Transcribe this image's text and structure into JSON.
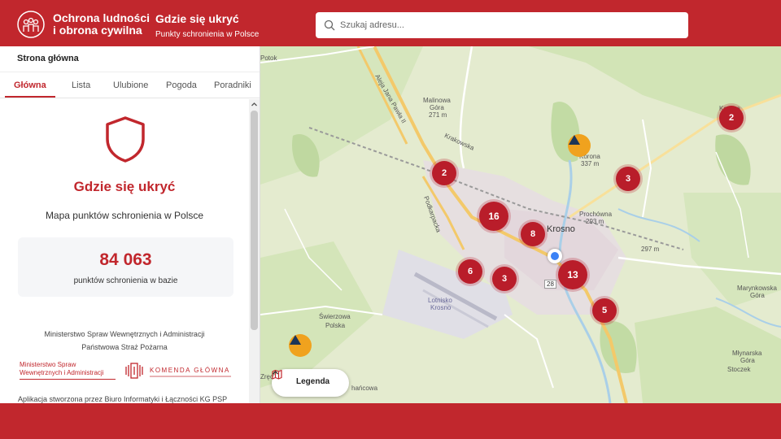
{
  "header": {
    "org_line1": "Ochrona ludności",
    "org_line2": "i obrona cywilna",
    "app_title": "Gdzie się ukryć",
    "app_subtitle": "Punkty schronienia w Polsce",
    "search_placeholder": "Szukaj adresu..."
  },
  "sidebar": {
    "heading": "Strona główna",
    "tabs": [
      {
        "label": "Główna",
        "active": true
      },
      {
        "label": "Lista",
        "active": false
      },
      {
        "label": "Ulubione",
        "active": false
      },
      {
        "label": "Pogoda",
        "active": false
      },
      {
        "label": "Poradniki",
        "active": false
      }
    ],
    "hero_title": "Gdzie się ukryć",
    "hero_subtitle": "Mapa punktów schronienia w Polsce",
    "stat_value": "84 063",
    "stat_label": "punktów schronienia w bazie",
    "ministry_line": "Ministerstwo Spraw Wewnętrznych i Administracji",
    "fire_service_line": "Państwowa Straż Pożarna",
    "mswia_logo_line1": "Ministerstwo Spraw",
    "mswia_logo_line2": "Wewnętrznych i Administracji",
    "kgpsp_logo_text": "KOMENDA GŁÓWNA",
    "credits": "Aplikacja stworzona przez Biuro Informatyki i Łączności KG PSP"
  },
  "map": {
    "clusters": [
      {
        "count": "2"
      },
      {
        "count": "2"
      },
      {
        "count": "3"
      },
      {
        "count": "16"
      },
      {
        "count": "8"
      },
      {
        "count": "6"
      },
      {
        "count": "3"
      },
      {
        "count": "13"
      },
      {
        "count": "5"
      }
    ],
    "labels": {
      "krosno": "Krosno",
      "malinowa": "Malinowa",
      "gora": "Góra",
      "malinowa_ele": "271 m",
      "korona": "Korona",
      "korona_ele": "337 m",
      "prochowna": "Prochówna",
      "prochowna_ele": "293 m",
      "ele_297": "297 m",
      "lotnisko": "Lotnisko",
      "lotnisko2": "Krosno",
      "swierzowa1": "Świerzowa",
      "swierzowa2": "Polska",
      "potok": "Potok",
      "marynkowska1": "Marynkowska",
      "marynkowska2": "Góra",
      "mlynarska1": "Młynarska",
      "mlynarska2": "Góra",
      "stoczek": "Stoczek",
      "korona_top": "Korona",
      "zreci": "Zręci",
      "bottom_place": "hańcowa",
      "road_28": "28",
      "road_krakowska": "Krakowska",
      "road_podkarpacka": "Podkarpacka",
      "road_pawla": "Aleja Jana Pawła II"
    },
    "legend_label": "Legenda"
  },
  "colors": {
    "brand_red": "#c1272d",
    "cluster_red": "#b91d2a",
    "marker_orange": "#f0a21e",
    "location_blue": "#3b82f6"
  }
}
